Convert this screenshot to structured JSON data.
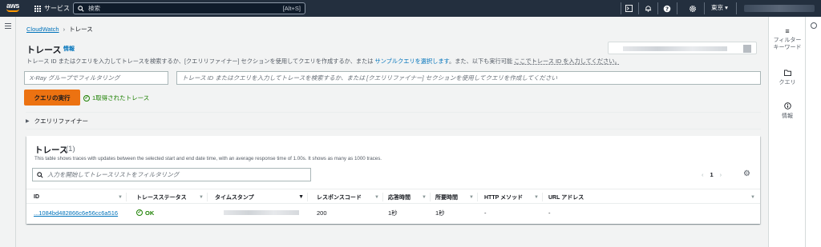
{
  "topnav": {
    "logo_text": "aws",
    "services_label": "サービス",
    "search_placeholder": "検索",
    "search_shortcut": "[Alt+S]",
    "region": "東京 ▾",
    "icons": [
      "cloudshell-icon",
      "bell-icon",
      "help-icon",
      "settings-icon"
    ]
  },
  "breadcrumb": {
    "root": "CloudWatch",
    "current": "トレース"
  },
  "page": {
    "title": "トレース",
    "info": "情報",
    "description_part1": "トレース ID またはクエリを入力してトレースを検索するか、[クエリリファイナー] セクションを使用してクエリを作成するか、または",
    "description_link": "サンプルクエリを選択します",
    "description_part2": "。また、以下も実行可能",
    "description_link2": "ここでトレース ID を入力してください。"
  },
  "inputs": {
    "xray_placeholder": "X-Ray グループでフィルタリング",
    "query_placeholder": "トレース ID またはクエリを入力してトレースを検索するか、または [クエリリファイナー] セクションを使用してクエリを作成してください"
  },
  "actions": {
    "run_query": "クエリの実行",
    "status": "1取得されたトレース"
  },
  "refiner": {
    "label": "クエリリファイナー"
  },
  "traces": {
    "title": "トレース",
    "count": "(1)",
    "description": "This table shows traces with updates between the selected start and end date time, with an average response time of 1.00s. It shows as many as 1000 traces.",
    "filter_placeholder": "入力を開始してトレースリストをフィルタリング",
    "page": "1",
    "columns": [
      "ID",
      "トレースステータス",
      "タイムスタンプ",
      "レスポンスコード",
      "応答時間",
      "所要時間",
      "HTTP メソッド",
      "URL アドレス"
    ],
    "rows": [
      {
        "id": "...1084bd482866c6e56cc6a516",
        "status": "OK",
        "response_code": "200",
        "response_time": "1秒",
        "duration": "1秒",
        "http_method": "-",
        "url": "-"
      }
    ]
  },
  "right_rail": {
    "filter_keyword": "フィルターキーワード",
    "query": "クエリ",
    "info": "情報"
  },
  "colors": {
    "nav_bg": "#232f3e",
    "accent": "#ec7211",
    "link": "#0073bb",
    "success": "#1d8102"
  }
}
